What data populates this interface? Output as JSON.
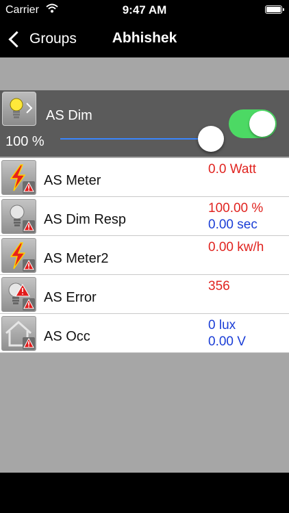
{
  "status_bar": {
    "carrier": "Carrier",
    "time": "9:47 AM"
  },
  "nav": {
    "back_label": "Groups",
    "title": "Abhishek"
  },
  "dimmer": {
    "name": "AS Dim",
    "percent_label": "100 %",
    "level": 1.0,
    "on": true
  },
  "devices": [
    {
      "name": "AS Meter",
      "icon": "lightning-icon",
      "value1": "0.0 Watt",
      "value2": ""
    },
    {
      "name": "AS Dim Resp",
      "icon": "bulb-icon",
      "value1": "100.00 %",
      "value2": "0.00  sec"
    },
    {
      "name": "AS Meter2",
      "icon": "lightning-icon",
      "value1": "0.00 kw/h",
      "value2": ""
    },
    {
      "name": "AS Error",
      "icon": "bulb-error-icon",
      "value1": "356",
      "value2": ""
    },
    {
      "name": "AS Occ",
      "icon": "house-occupancy-icon",
      "value1": "0 lux",
      "value2": "0.00 V"
    }
  ],
  "colors": {
    "value_red": "#e0231f",
    "value_blue": "#1a3dd6",
    "toggle_on": "#4cd964",
    "slider_track": "#3a86ff"
  }
}
